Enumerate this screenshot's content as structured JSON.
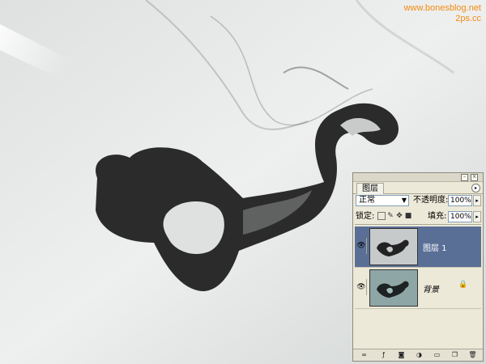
{
  "watermark": {
    "line1": "www.bonesblog.net",
    "line2": "2ps.cc"
  },
  "layers_panel": {
    "tab_label": "图层",
    "blend_mode": "正常",
    "opacity_label": "不透明度:",
    "opacity_value": "100%",
    "lock_label": "锁定:",
    "fill_label": "填充:",
    "fill_value": "100%",
    "layers": [
      {
        "name": "图层 1",
        "selected": true,
        "visible": true
      },
      {
        "name": "背景",
        "selected": false,
        "visible": true,
        "locked": true
      }
    ],
    "footer_icons": [
      "link-icon",
      "layer-style-icon",
      "mask-icon",
      "adjustment-icon",
      "group-icon",
      "new-layer-icon",
      "delete-icon"
    ]
  },
  "colors": {
    "watermark": "#f28b10",
    "selection": "#5a6f96",
    "panel_bg": "#ece9d8"
  }
}
